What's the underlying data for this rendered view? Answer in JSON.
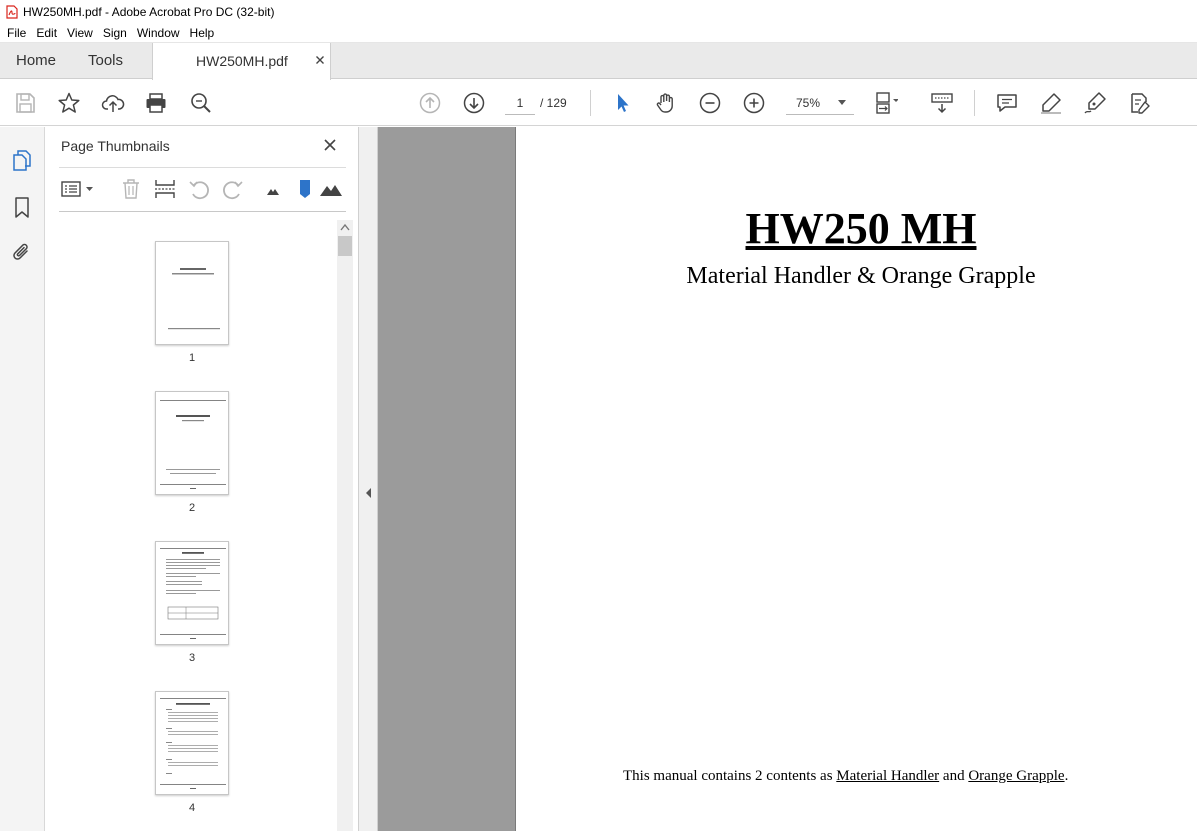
{
  "window": {
    "title": "HW250MH.pdf - Adobe Acrobat Pro DC (32-bit)"
  },
  "menu": [
    "File",
    "Edit",
    "View",
    "Sign",
    "Window",
    "Help"
  ],
  "tabs": {
    "home": "Home",
    "tools": "Tools",
    "document": "HW250MH.pdf"
  },
  "toolbar": {
    "page_current": "1",
    "page_total": "/ 129",
    "zoom": "75%"
  },
  "thumbnail_panel": {
    "title": "Page Thumbnails",
    "pages": [
      "1",
      "2",
      "3",
      "4"
    ]
  },
  "document": {
    "title": "HW250 MH",
    "subtitle": "Material Handler & Orange Grapple",
    "footer_prefix": "This manual contains 2 contents as ",
    "footer_link1": "Material Handler",
    "footer_mid": " and ",
    "footer_link2": "Orange Grapple",
    "footer_end": "."
  },
  "colors": {
    "accent_blue": "#2d74c9",
    "viewer_gray": "#9b9b9b",
    "pdf_red": "#d9241c"
  }
}
